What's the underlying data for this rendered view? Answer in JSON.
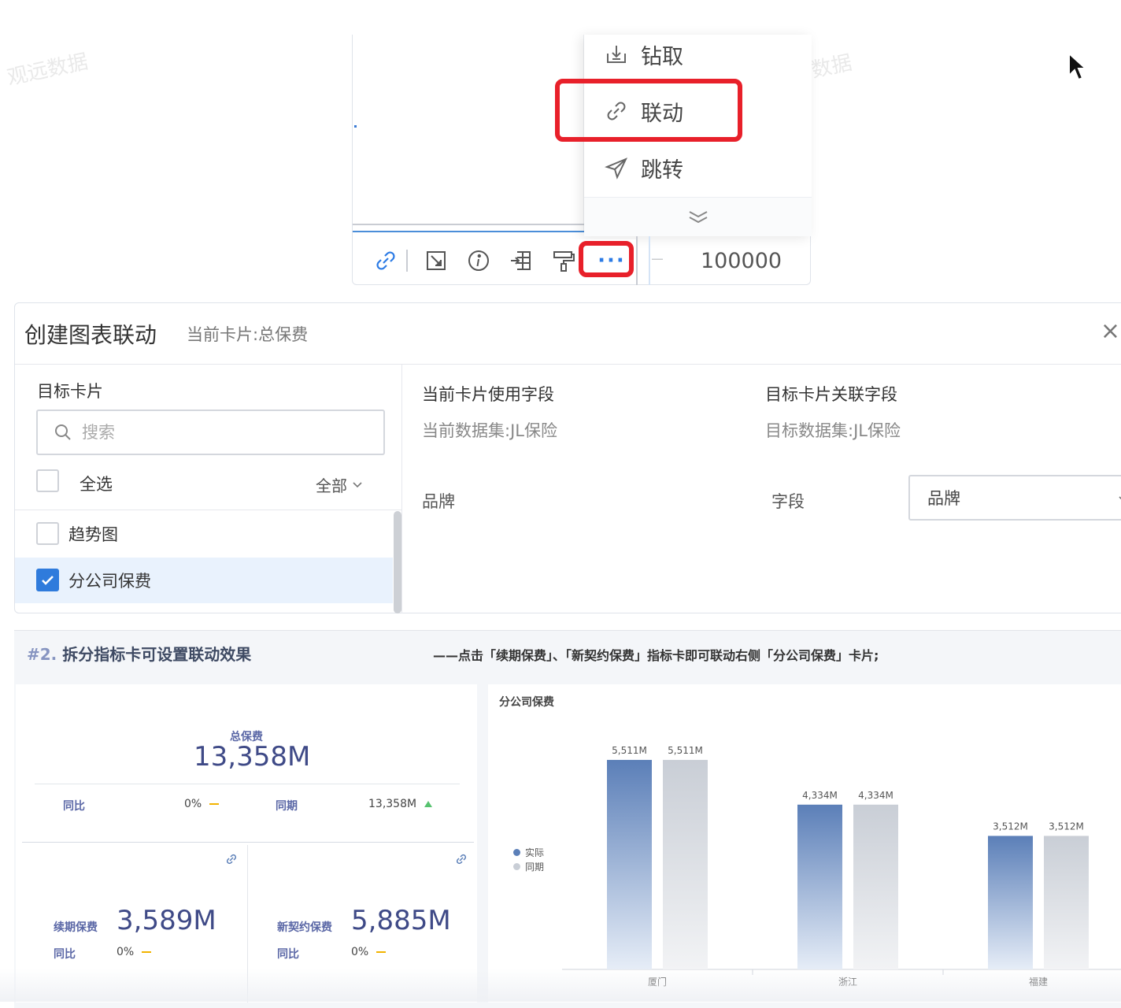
{
  "watermark": "观远数据",
  "context_menu": {
    "items": [
      {
        "label": "钻取",
        "icon": "drill-icon"
      },
      {
        "label": "联动",
        "icon": "link-icon"
      },
      {
        "label": "跳转",
        "icon": "send-icon"
      }
    ],
    "more_icon": "chevron-double-down-icon"
  },
  "toolbar": {
    "icons": [
      "link-icon",
      "expand-icon",
      "info-icon",
      "export-icon",
      "format-painter-icon"
    ],
    "more_label": "···",
    "value": "100000"
  },
  "dialog": {
    "title": "创建图表联动",
    "subtitle": "当前卡片:总保费",
    "close_icon": "×",
    "left": {
      "label": "目标卡片",
      "search_placeholder": "搜索",
      "select_all": "全选",
      "filter": "全部",
      "items": [
        {
          "label": "趋势图",
          "checked": false
        },
        {
          "label": "分公司保费",
          "checked": true
        }
      ]
    },
    "right": {
      "current_header": "当前卡片使用字段",
      "current_dataset": "当前数据集:JL保险",
      "target_header": "目标卡片关联字段",
      "target_dataset": "目标数据集:JL保险",
      "current_field": "品牌",
      "field_label": "字段",
      "target_field": "品牌"
    }
  },
  "dashboard": {
    "hash": "#2.",
    "title": "拆分指标卡可设置联动效果",
    "note": "——点击「续期保费」、「新契约保费」指标卡即可联动右侧「分公司保费」卡片;",
    "total": {
      "name": "总保费",
      "value": "13,358M",
      "yoy_label": "同比",
      "yoy_value": "0%",
      "period_label": "同期",
      "period_value": "13,358M"
    },
    "renewal": {
      "name": "续期保费",
      "value": "3,589M",
      "yoy_label": "同比",
      "yoy_value": "0%"
    },
    "new_contract": {
      "name": "新契约保费",
      "value": "5,885M",
      "yoy_label": "同比",
      "yoy_value": "0%"
    },
    "chart_title": "分公司保费"
  },
  "chart_data": {
    "type": "bar",
    "title": "分公司保费",
    "categories": [
      "厦门",
      "浙江",
      "福建"
    ],
    "series": [
      {
        "name": "实际",
        "values": [
          5511,
          4334,
          3512
        ],
        "labels": [
          "5,511M",
          "4,334M",
          "3,512M"
        ],
        "color": "#5b7fb8"
      },
      {
        "name": "同期",
        "values": [
          5511,
          4334,
          3512
        ],
        "labels": [
          "5,511M",
          "4,334M",
          "3,512M"
        ],
        "color": "#c9ced6"
      }
    ],
    "ylim": [
      0,
      5800
    ],
    "legend_position": "left",
    "grid": false
  },
  "colors": {
    "accent": "#2f7bdc",
    "highlight": "#e8202a",
    "kpi_text": "#3f4a87"
  }
}
